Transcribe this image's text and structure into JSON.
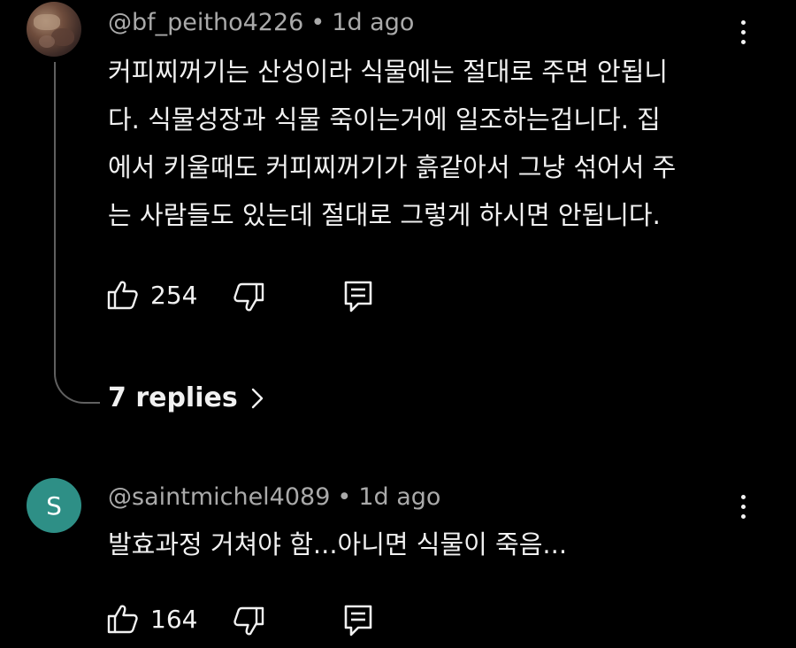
{
  "comments": [
    {
      "author": "@bf_peitho4226",
      "separator": "•",
      "time": "1d ago",
      "avatar_icon": "user-photo-avatar",
      "lines": [
        "커피찌꺼기는 산성이라 식물에는 절대로 주면 안됩니",
        "다. 식물성장과 식물 죽이는거에 일조하는겁니다. 집",
        "에서 키울때도 커피찌꺼기가 흙같아서 그냥 섞어서 주",
        "는 사람들도 있는데 절대로 그렇게 하시면 안됩니다."
      ],
      "likes": "254",
      "replies_label": "7 replies"
    },
    {
      "author": "@saintmichel4089",
      "separator": "•",
      "time": "1d ago",
      "avatar_letter": "S",
      "avatar_color": "#2e8f86",
      "lines": [
        "발효과정 거쳐야 함...아니면 식물이 죽음..."
      ],
      "likes": "164"
    }
  ],
  "icons": {
    "like": "thumbs-up-icon",
    "dislike": "thumbs-down-icon",
    "reply": "reply-comment-icon",
    "menu": "more-vert-icon",
    "chevron": "chevron-right-icon"
  },
  "colors": {
    "background": "#000000",
    "text": "#f1f1f1",
    "meta": "#aaaaaa",
    "thread_line": "#606060"
  }
}
